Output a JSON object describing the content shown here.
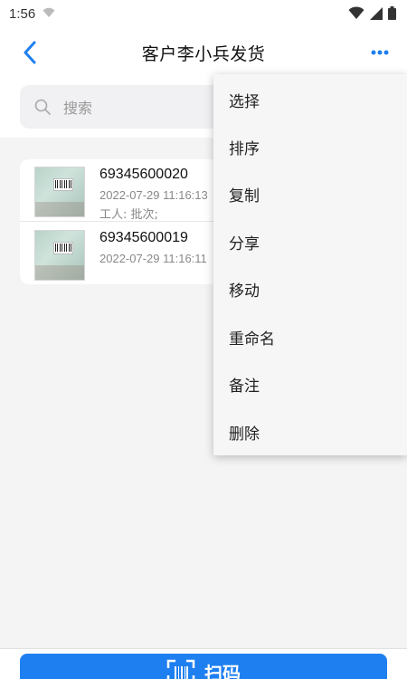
{
  "status_bar": {
    "time": "1:56"
  },
  "header": {
    "title": "客户李小兵发货"
  },
  "search": {
    "placeholder": "搜索"
  },
  "items": [
    {
      "code": "69345600020",
      "time": "2022-07-29 11:16:13",
      "note": "工人: 批次;"
    },
    {
      "code": "69345600019",
      "time": "2022-07-29 11:16:11",
      "note": ""
    }
  ],
  "menu": {
    "items": [
      "选择",
      "排序",
      "复制",
      "分享",
      "移动",
      "重命名",
      "备注",
      "删除"
    ]
  },
  "bottom": {
    "scan_label": "扫码"
  },
  "colors": {
    "accent": "#1e7ff0",
    "menu_bg": "#f6f6f6",
    "page_bg": "#f4f4f4"
  }
}
